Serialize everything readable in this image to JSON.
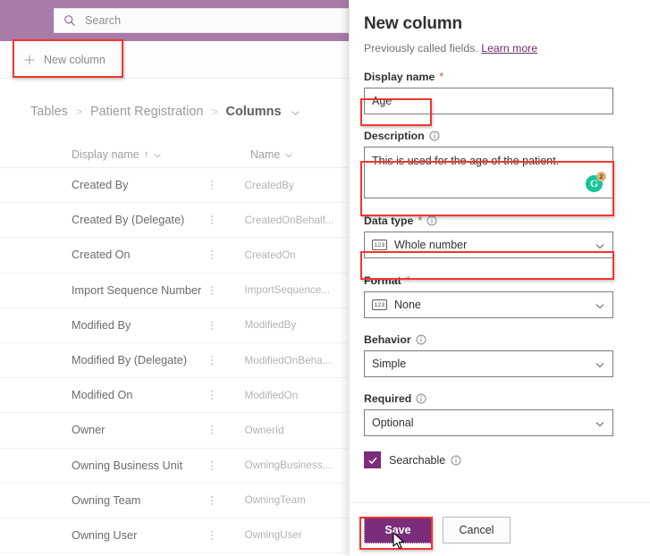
{
  "topbar": {
    "search": {
      "placeholder": "Search",
      "icon": "search-icon"
    }
  },
  "commandbar": {
    "new_column_label": "New column",
    "new_column_icon": "plus-icon"
  },
  "breadcrumb": {
    "items": [
      "Tables",
      "Patient Registration",
      "Columns"
    ],
    "separator": ">",
    "chevron_icon": "chevron-down-icon"
  },
  "table": {
    "columns": [
      {
        "label": "Display name",
        "sort": "↑",
        "chevron": "⌄"
      },
      {
        "label": "Name",
        "chevron": "⌄"
      }
    ],
    "rows": [
      {
        "display_name": "Created By",
        "name": "CreatedBy"
      },
      {
        "display_name": "Created By (Delegate)",
        "name": "CreatedOnBehalf..."
      },
      {
        "display_name": "Created On",
        "name": "CreatedOn"
      },
      {
        "display_name": "Import Sequence Number",
        "name": "ImportSequence..."
      },
      {
        "display_name": "Modified By",
        "name": "ModifiedBy"
      },
      {
        "display_name": "Modified By (Delegate)",
        "name": "ModifiedOnBeha..."
      },
      {
        "display_name": "Modified On",
        "name": "ModifiedOn"
      },
      {
        "display_name": "Owner",
        "name": "OwnerId"
      },
      {
        "display_name": "Owning Business Unit",
        "name": "OwningBusiness..."
      },
      {
        "display_name": "Owning Team",
        "name": "OwningTeam"
      },
      {
        "display_name": "Owning User",
        "name": "OwningUser"
      }
    ]
  },
  "panel": {
    "title": "New column",
    "subtitle_text": "Previously called fields.",
    "subtitle_link": "Learn more",
    "fields": {
      "display_name": {
        "label": "Display name",
        "required_marker": "*",
        "value": "Age"
      },
      "description": {
        "label": "Description",
        "info_icon": "info-icon",
        "value": "This is used for the age of the patient.",
        "grammarly": {
          "letter": "G",
          "badge_count": "2"
        }
      },
      "data_type": {
        "label": "Data type",
        "required_marker": "*",
        "info_icon": "info-icon",
        "value": "Whole number",
        "value_icon": "123",
        "chevron_icon": "chevron-down-icon"
      },
      "format": {
        "label": "Format",
        "required_marker": "*",
        "value": "None",
        "value_icon": "123",
        "chevron_icon": "chevron-down-icon"
      },
      "behavior": {
        "label": "Behavior",
        "info_icon": "info-icon",
        "value": "Simple",
        "chevron_icon": "chevron-down-icon"
      },
      "required": {
        "label": "Required",
        "info_icon": "info-icon",
        "value": "Optional",
        "chevron_icon": "chevron-down-icon"
      },
      "searchable": {
        "label": "Searchable",
        "checked": true,
        "info_icon": "info-icon"
      }
    },
    "footer": {
      "save_label": "Save",
      "cancel_label": "Cancel"
    }
  },
  "colors": {
    "brand_purple": "#7b2d7b",
    "topbar_purple": "#a97ba9",
    "annotation_red": "#f4352f",
    "grammarly_green": "#15c39a",
    "grammarly_badge": "#dcb679"
  }
}
